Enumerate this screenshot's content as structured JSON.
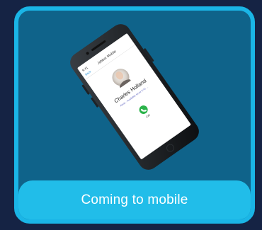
{
  "card": {
    "caption": "Coming to mobile"
  },
  "phone": {
    "status_time": "9:41",
    "back_label": "Back",
    "header_title": "Jabber Mobile",
    "contact_name": "Charles Holland",
    "contact_detail": "Away · Available since 9:41 ...",
    "call_label": "Call"
  },
  "colors": {
    "page_background": "#152344",
    "card_border": "#1ab5e6",
    "card_fill": "#0f638a",
    "caption_bar": "#21bde9",
    "call_button": "#2bb34a"
  },
  "icons": {
    "call": "phone-icon",
    "avatar": "avatar-photo"
  }
}
